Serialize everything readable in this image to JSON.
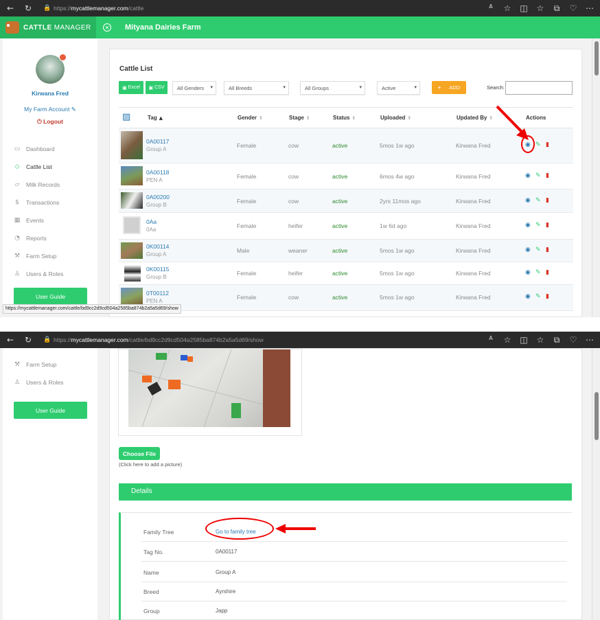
{
  "browser1": {
    "url_proto": "https://",
    "url_host": "mycattlemanager.com",
    "url_path": "/cattle"
  },
  "browser2": {
    "url_proto": "https://",
    "url_host": "mycattlemanager.com",
    "url_path": "/cattle/bd9cc2d9cd504a2585ba874b2a5a5d69/show"
  },
  "app": {
    "brand_bold": "CATTLE",
    "brand_light": "MANAGER",
    "farm_name": "Mityana Dairies Farm"
  },
  "sidebar": {
    "user_name": "Kirwana Fred",
    "my_account": "My Farm Account",
    "logout": "Logout",
    "items": [
      {
        "label": "Dashboard",
        "icon": "monitor-icon"
      },
      {
        "label": "Cattle List",
        "icon": "tag-icon"
      },
      {
        "label": "Milk Records",
        "icon": "bucket-icon"
      },
      {
        "label": "Transactions",
        "icon": "dollar-icon"
      },
      {
        "label": "Events",
        "icon": "calendar-icon"
      },
      {
        "label": "Reports",
        "icon": "chart-icon"
      },
      {
        "label": "Farm Setup",
        "icon": "wrench-icon"
      },
      {
        "label": "Users & Roles",
        "icon": "users-icon"
      }
    ],
    "user_guide": "User Guide"
  },
  "status_url": "https://mycattlemanager.com/cattle/bd9cc2d9cd504a2585ba874b2a5a5d69/show",
  "cattle_list": {
    "title": "Cattle List",
    "excel": "Excel",
    "csv": "CSV",
    "filters": {
      "gender": "All Genders",
      "breed": "All Breeds",
      "group": "All Groups",
      "status": "Active"
    },
    "add": "ADD",
    "search_label": "Search:",
    "columns": {
      "tag": "Tag",
      "gender": "Gender",
      "stage": "Stage",
      "status": "Status",
      "uploaded": "Uploaded",
      "updated_by": "Updated By",
      "actions": "Actions"
    },
    "rows": [
      {
        "tag": "0A00117",
        "group": "Group A",
        "gender": "Female",
        "stage": "cow",
        "status": "active",
        "uploaded": "5mos 1w ago",
        "updated_by": "Kirwana Fred"
      },
      {
        "tag": "0A00118",
        "group": "PEN A",
        "gender": "Female",
        "stage": "cow",
        "status": "active",
        "uploaded": "6mos 4w ago",
        "updated_by": "Kirwana Fred"
      },
      {
        "tag": "0A00200",
        "group": "Group B",
        "gender": "Female",
        "stage": "cow",
        "status": "active",
        "uploaded": "2yrs 11mos ago",
        "updated_by": "Kirwana Fred"
      },
      {
        "tag": "0Aa",
        "group": "0Aa",
        "gender": "Female",
        "stage": "heifer",
        "status": "active",
        "uploaded": "1w 6d ago",
        "updated_by": "Kirwana Fred"
      },
      {
        "tag": "0K00114",
        "group": "Group A",
        "gender": "Male",
        "stage": "weaner",
        "status": "active",
        "uploaded": "5mos 1w ago",
        "updated_by": "Kirwana Fred"
      },
      {
        "tag": "0K00115",
        "group": "Group B",
        "gender": "Female",
        "stage": "heifer",
        "status": "active",
        "uploaded": "5mos 1w ago",
        "updated_by": "Kirwana Fred"
      },
      {
        "tag": "0T00112",
        "group": "PEN A",
        "gender": "Female",
        "stage": "cow",
        "status": "active",
        "uploaded": "5mos 1w ago",
        "updated_by": "Kirwana Fred"
      }
    ]
  },
  "detail_page": {
    "choose_file": "Choose File",
    "hint": "(Click here to add a picture)",
    "details_title": "Details",
    "fields": [
      {
        "label": "Family Tree",
        "value": "Go to family tree"
      },
      {
        "label": "Tag No.",
        "value": "0A00117"
      },
      {
        "label": "Name",
        "value": "Group A"
      },
      {
        "label": "Breed",
        "value": "Ayrshire"
      },
      {
        "label": "Group",
        "value": "Japp"
      }
    ]
  },
  "colors": {
    "brand_green": "#2ecc6f",
    "add_orange": "#f6a623",
    "link_blue": "#2a7ab0",
    "annotation_red": "#e00000"
  }
}
